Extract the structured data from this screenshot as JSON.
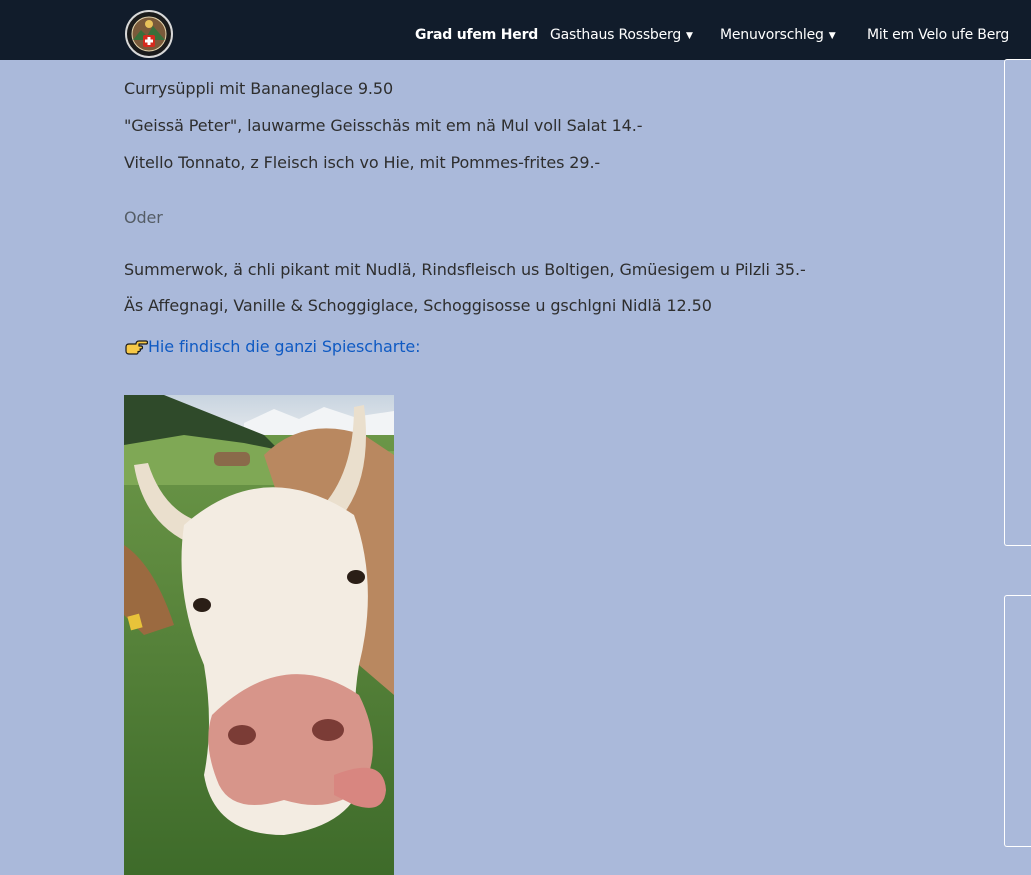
{
  "nav": {
    "items": [
      {
        "label": "Grad ufem Herd",
        "dropdown": false,
        "active": true
      },
      {
        "label": "Gasthaus Rossberg",
        "dropdown": true,
        "active": false
      },
      {
        "label": "Menuvorschleg",
        "dropdown": true,
        "active": false
      },
      {
        "label": "Mit em Velo ufe Berg",
        "dropdown": false,
        "active": false
      }
    ]
  },
  "menu": {
    "line1": "Currysüppli mit Bananeglace 9.50",
    "line2": "\"Geissä Peter\", lauwarme Geisschäs mit em nä Mul voll Salat 14.-",
    "line3": "Vitello Tonnato, z Fleisch isch vo Hie, mit Pommes-frites 29.-",
    "oder": "Oder",
    "line4": "Summerwok, ä chli pikant mit Nudlä, Rindsfleisch us Boltigen,  Gmüesigem u Pilzli 35.-",
    "line5": "Äs Affegnagi, Vanille & Schoggiglace, Schoggisosse u gschlgni Nidlä 12.50",
    "link": "Hie findisch die ganzi Spiescharte:"
  },
  "icons": {
    "logo": "swiss-badge-logo",
    "hand": "pointing-hand-icon",
    "chevron": "chevron-down-icon"
  },
  "colors": {
    "nav_bg": "#111c2b",
    "page_bg": "#aab9da",
    "link": "#0f5ac3",
    "text": "#2e2e2e"
  }
}
